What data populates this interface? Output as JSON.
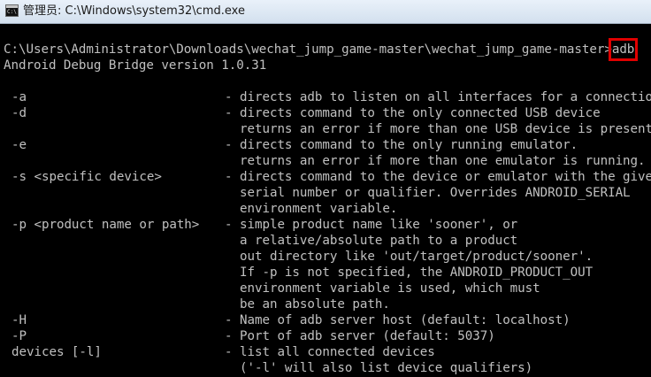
{
  "window": {
    "title": "管理员: C:\\Windows\\system32\\cmd.exe",
    "icon": "cmd-console-icon"
  },
  "console": {
    "prompt": "C:\\Users\\Administrator\\Downloads\\wechat_jump_game-master\\wechat_jump_game-master>",
    "command": "adb",
    "highlight_color": "#e00000",
    "version_line": "Android Debug Bridge version 1.0.31",
    "options": [
      {
        "flag": "-a",
        "desc": [
          "- directs adb to listen on all interfaces for a connection"
        ]
      },
      {
        "flag": "-d",
        "desc": [
          "- directs command to the only connected USB device",
          "  returns an error if more than one USB device is present."
        ]
      },
      {
        "flag": "-e",
        "desc": [
          "- directs command to the only running emulator.",
          "  returns an error if more than one emulator is running."
        ]
      },
      {
        "flag": "-s <specific device>",
        "desc": [
          "- directs command to the device or emulator with the given",
          "  serial number or qualifier. Overrides ANDROID_SERIAL",
          "  environment variable."
        ]
      },
      {
        "flag": "-p <product name or path>",
        "desc": [
          "- simple product name like 'sooner', or",
          "  a relative/absolute path to a product",
          "  out directory like 'out/target/product/sooner'.",
          "  If -p is not specified, the ANDROID_PRODUCT_OUT",
          "  environment variable is used, which must",
          "  be an absolute path."
        ]
      },
      {
        "flag": "-H",
        "desc": [
          "- Name of adb server host (default: localhost)"
        ]
      },
      {
        "flag": "-P",
        "desc": [
          "- Port of adb server (default: 5037)"
        ]
      },
      {
        "flag": "devices [-l]",
        "desc": [
          "- list all connected devices",
          "  ('-l' will also list device qualifiers)"
        ]
      }
    ]
  }
}
